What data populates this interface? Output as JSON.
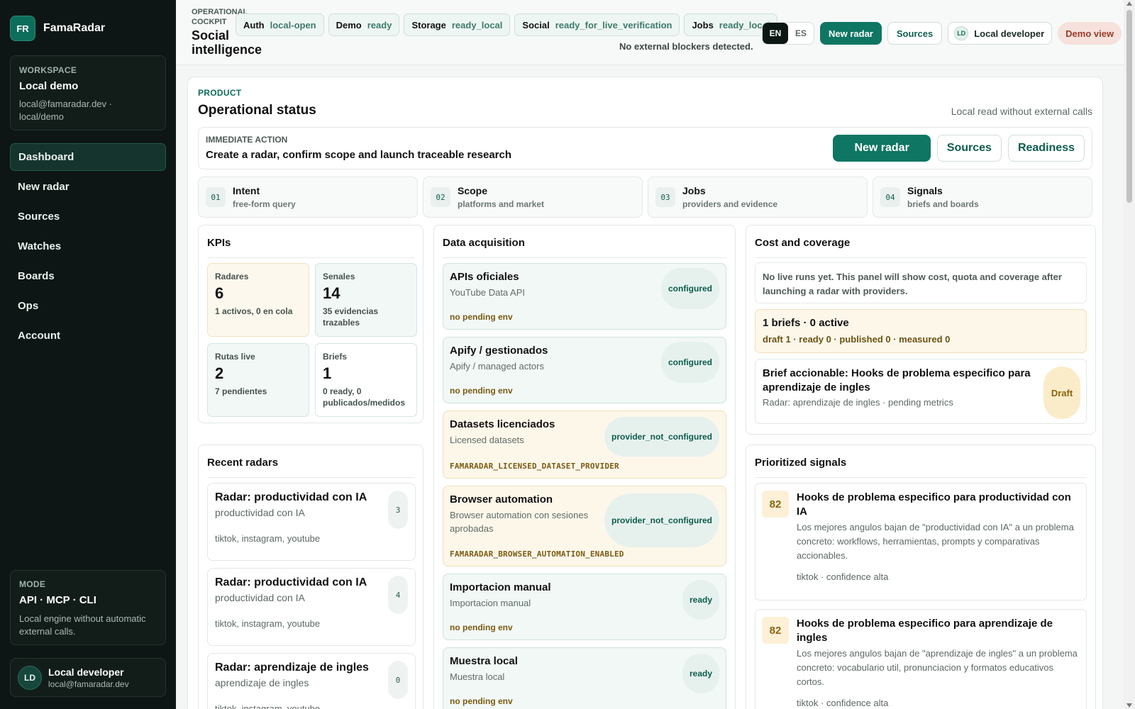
{
  "brand": {
    "logo": "FR",
    "name": "FamaRadar"
  },
  "workspace": {
    "eyebrow": "WORKSPACE",
    "title": "Local demo",
    "subtitle": "local@famaradar.dev · local/demo"
  },
  "nav": [
    "Dashboard",
    "New radar",
    "Sources",
    "Watches",
    "Boards",
    "Ops",
    "Account"
  ],
  "mode": {
    "eyebrow": "MODE",
    "title": "API · MCP · CLI",
    "subtitle": "Local engine without automatic external calls."
  },
  "user": {
    "initials": "LD",
    "name": "Local developer",
    "email": "local@famaradar.dev"
  },
  "topbar": {
    "eyebrow": "OPERATIONAL COCKPIT",
    "title": "Social intelligence",
    "chips": [
      {
        "key": "Auth",
        "value": "local-open"
      },
      {
        "key": "Demo",
        "value": "ready"
      },
      {
        "key": "Storage",
        "value": "ready_local"
      },
      {
        "key": "Social",
        "value": "ready_for_live_verification"
      },
      {
        "key": "Jobs",
        "value": "ready_local"
      }
    ],
    "blockers": "No external blockers detected.",
    "lang_en": "EN",
    "lang_es": "ES",
    "new_radar": "New radar",
    "sources": "Sources",
    "user_initials": "LD",
    "user_name": "Local developer",
    "demo_view": "Demo view"
  },
  "product": {
    "eyebrow": "PRODUCT",
    "title": "Operational status",
    "note": "Local read without external calls"
  },
  "action": {
    "eyebrow": "IMMEDIATE ACTION",
    "text": "Create a radar, confirm scope and launch traceable research",
    "new_radar": "New radar",
    "sources": "Sources",
    "readiness": "Readiness"
  },
  "steps": [
    {
      "num": "01",
      "title": "Intent",
      "sub": "free-form query"
    },
    {
      "num": "02",
      "title": "Scope",
      "sub": "platforms and market"
    },
    {
      "num": "03",
      "title": "Jobs",
      "sub": "providers and evidence"
    },
    {
      "num": "04",
      "title": "Signals",
      "sub": "briefs and boards"
    }
  ],
  "kpis": {
    "title": "KPIs",
    "items": [
      {
        "label": "Radares",
        "value": "6",
        "sub": "1 activos, 0 en cola"
      },
      {
        "label": "Senales",
        "value": "14",
        "sub": "35 evidencias trazables"
      },
      {
        "label": "Rutas live",
        "value": "2",
        "sub": "7 pendientes"
      },
      {
        "label": "Briefs",
        "value": "1",
        "sub": "0 ready, 0 publicados/medidos"
      }
    ]
  },
  "recent": {
    "title": "Recent radars",
    "items": [
      {
        "title": "Radar: productividad con IA",
        "sub": "productividad con IA",
        "platforms": "tiktok, instagram, youtube",
        "count": "3"
      },
      {
        "title": "Radar: productividad con IA",
        "sub": "productividad con IA",
        "platforms": "tiktok, instagram, youtube",
        "count": "4"
      },
      {
        "title": "Radar: aprendizaje de ingles",
        "sub": "aprendizaje de ingles",
        "platforms": "tiktok, instagram, youtube",
        "count": "0"
      }
    ]
  },
  "acquisition": {
    "title": "Data acquisition",
    "items": [
      {
        "name": "APIs oficiales",
        "desc": "YouTube Data API",
        "env": "no pending env",
        "status": "configured"
      },
      {
        "name": "Apify / gestionados",
        "desc": "Apify / managed actors",
        "env": "no pending env",
        "status": "configured"
      },
      {
        "name": "Datasets licenciados",
        "desc": "Licensed datasets",
        "env": "FAMARADAR_LICENSED_DATASET_PROVIDER",
        "status": "provider_not_configured"
      },
      {
        "name": "Browser automation",
        "desc": "Browser automation con sesiones aprobadas",
        "env": "FAMARADAR_BROWSER_AUTOMATION_ENABLED",
        "status": "provider_not_configured"
      },
      {
        "name": "Importacion manual",
        "desc": "Importacion manual",
        "env": "no pending env",
        "status": "ready"
      },
      {
        "name": "Muestra local",
        "desc": "Muestra local",
        "env": "no pending env",
        "status": "ready"
      }
    ]
  },
  "cost": {
    "title": "Cost and coverage",
    "note": "No live runs yet. This panel will show cost, quota and coverage after launching a radar with providers.",
    "briefs_title": "1 briefs · 0 active",
    "briefs_sub": "draft 1 · ready 0 · published 0 · measured 0",
    "brief_title": "Brief accionable: Hooks de problema especifico para aprendizaje de ingles",
    "brief_sub": "Radar: aprendizaje de ingles · pending metrics",
    "brief_status": "Draft"
  },
  "signals": {
    "title": "Prioritized signals",
    "items": [
      {
        "score": "82",
        "title": "Hooks de problema especifico para productividad con IA",
        "desc": "Los mejores angulos bajan de \"productividad con IA\" a un problema concreto: workflows, herramientas, prompts y comparativas accionables.",
        "platform": "tiktok · confidence alta"
      },
      {
        "score": "82",
        "title": "Hooks de problema especifico para aprendizaje de ingles",
        "desc": "Los mejores angulos bajan de \"aprendizaje de ingles\" a un problema concreto: vocabulario util, pronunciacion y formatos educativos cortos.",
        "platform": "tiktok · confidence alta"
      }
    ]
  }
}
